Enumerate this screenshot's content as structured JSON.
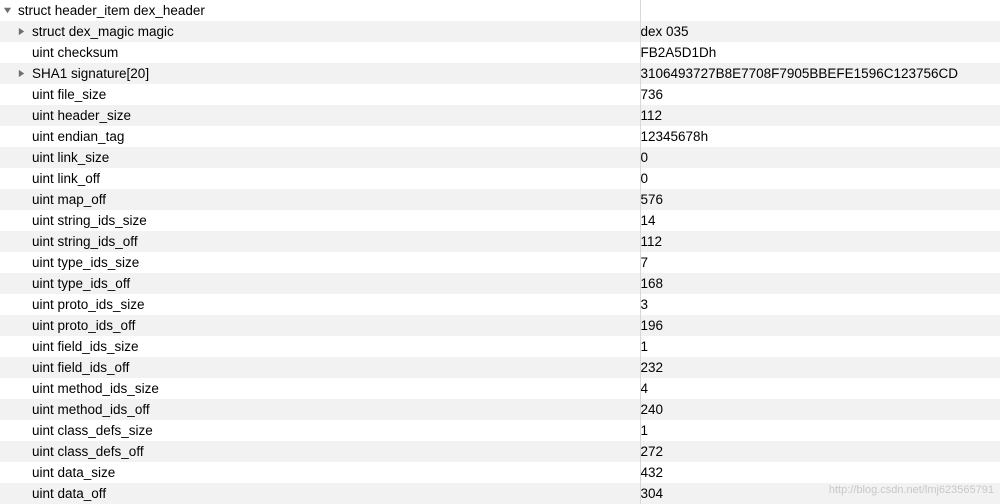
{
  "rows": [
    {
      "indent": 0,
      "arrow": "down",
      "name": "struct header_item dex_header",
      "value": ""
    },
    {
      "indent": 1,
      "arrow": "right",
      "name": "struct dex_magic magic",
      "value": "dex 035"
    },
    {
      "indent": 1,
      "arrow": "none",
      "name": "uint checksum",
      "value": "FB2A5D1Dh"
    },
    {
      "indent": 1,
      "arrow": "right",
      "name": "SHA1 signature[20]",
      "value": "3106493727B8E7708F7905BBEFE1596C123756CD"
    },
    {
      "indent": 1,
      "arrow": "none",
      "name": "uint file_size",
      "value": "736"
    },
    {
      "indent": 1,
      "arrow": "none",
      "name": "uint header_size",
      "value": "112"
    },
    {
      "indent": 1,
      "arrow": "none",
      "name": "uint endian_tag",
      "value": "12345678h"
    },
    {
      "indent": 1,
      "arrow": "none",
      "name": "uint link_size",
      "value": "0"
    },
    {
      "indent": 1,
      "arrow": "none",
      "name": "uint link_off",
      "value": "0"
    },
    {
      "indent": 1,
      "arrow": "none",
      "name": "uint map_off",
      "value": "576"
    },
    {
      "indent": 1,
      "arrow": "none",
      "name": "uint string_ids_size",
      "value": "14"
    },
    {
      "indent": 1,
      "arrow": "none",
      "name": "uint string_ids_off",
      "value": "112"
    },
    {
      "indent": 1,
      "arrow": "none",
      "name": "uint type_ids_size",
      "value": "7"
    },
    {
      "indent": 1,
      "arrow": "none",
      "name": "uint type_ids_off",
      "value": "168"
    },
    {
      "indent": 1,
      "arrow": "none",
      "name": "uint proto_ids_size",
      "value": "3"
    },
    {
      "indent": 1,
      "arrow": "none",
      "name": "uint proto_ids_off",
      "value": "196"
    },
    {
      "indent": 1,
      "arrow": "none",
      "name": "uint field_ids_size",
      "value": "1"
    },
    {
      "indent": 1,
      "arrow": "none",
      "name": "uint field_ids_off",
      "value": "232"
    },
    {
      "indent": 1,
      "arrow": "none",
      "name": "uint method_ids_size",
      "value": "4"
    },
    {
      "indent": 1,
      "arrow": "none",
      "name": "uint method_ids_off",
      "value": "240"
    },
    {
      "indent": 1,
      "arrow": "none",
      "name": "uint class_defs_size",
      "value": "1"
    },
    {
      "indent": 1,
      "arrow": "none",
      "name": "uint class_defs_off",
      "value": "272"
    },
    {
      "indent": 1,
      "arrow": "none",
      "name": "uint data_size",
      "value": "432"
    },
    {
      "indent": 1,
      "arrow": "none",
      "name": "uint data_off",
      "value": "304"
    }
  ],
  "watermark": "http://blog.csdn.net/lmj623565791"
}
